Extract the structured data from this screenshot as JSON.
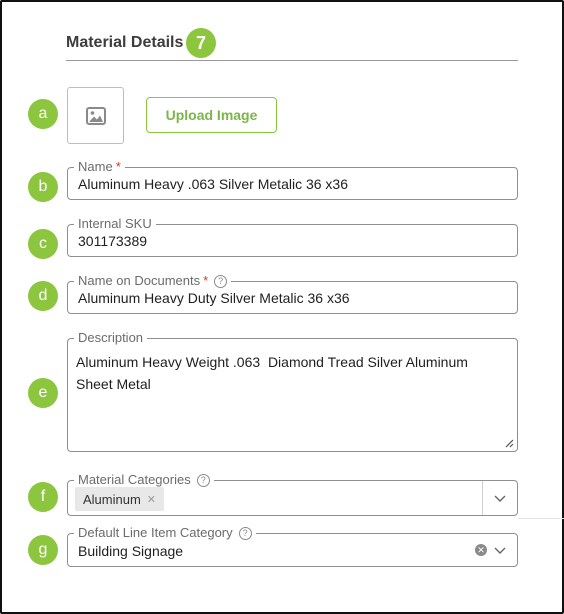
{
  "section": {
    "title": "Material Details",
    "step": "7"
  },
  "markers": {
    "a": "a",
    "b": "b",
    "c": "c",
    "d": "d",
    "e": "e",
    "f": "f",
    "g": "g"
  },
  "image": {
    "upload_label": "Upload Image",
    "placeholder_icon": "image-icon"
  },
  "fields": {
    "name": {
      "label": "Name",
      "required": "*",
      "value": "Aluminum Heavy .063 Silver Metalic 36 x36"
    },
    "sku": {
      "label": "Internal SKU",
      "value": "301173389"
    },
    "doc_name": {
      "label": "Name on Documents",
      "required": "*",
      "value": "Aluminum Heavy Duty Silver Metalic 36 x36",
      "help_icon": "question-circle-icon"
    },
    "description": {
      "label": "Description",
      "value": "Aluminum Heavy Weight .063  Diamond Tread Silver Aluminum Sheet Metal"
    },
    "categories": {
      "label": "Material Categories",
      "chips": [
        "Aluminum"
      ],
      "help_icon": "question-circle-icon"
    },
    "line_item_category": {
      "label": "Default Line Item Category",
      "value": "Building Signage",
      "help_icon": "question-circle-icon"
    }
  },
  "colors": {
    "accent": "#8cc63f",
    "required": "#d9342b",
    "border": "#8f8f8f"
  }
}
